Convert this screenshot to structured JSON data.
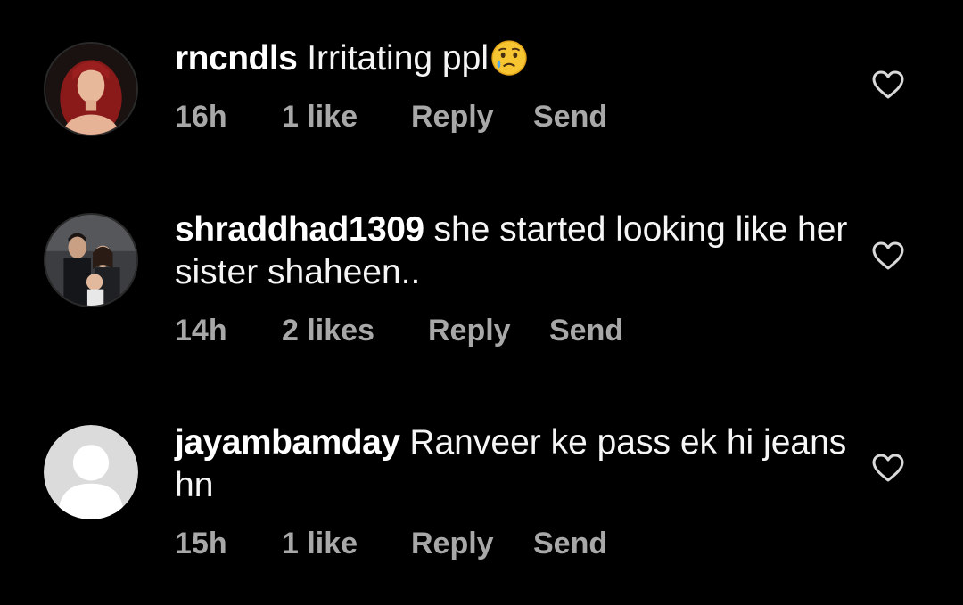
{
  "comments": [
    {
      "username": "rncndls",
      "text": "Irritating ppl",
      "emoji": "crying-face",
      "time": "16h",
      "likes": "1 like",
      "reply": "Reply",
      "send": "Send",
      "avatar": "photo-woman-red-hair"
    },
    {
      "username": "shraddhad1309",
      "text": "she started looking like her sister shaheen..",
      "time": "14h",
      "likes": "2 likes",
      "reply": "Reply",
      "send": "Send",
      "avatar": "photo-family"
    },
    {
      "username": "jayambamday",
      "text": "Ranveer ke pass ek hi jeans hn",
      "time": "15h",
      "likes": "1 like",
      "reply": "Reply",
      "send": "Send",
      "avatar": "default-profile"
    }
  ],
  "icons": {
    "like": "heart-outline-icon"
  },
  "colors": {
    "background": "#000000",
    "username": "#ffffff",
    "comment_text": "#f5f5f5",
    "meta": "#a8a8a8",
    "heart": "#d9d9d9"
  }
}
